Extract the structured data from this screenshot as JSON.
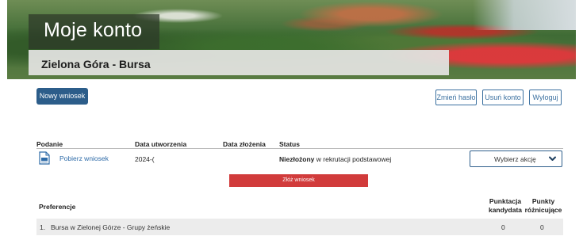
{
  "banner": {
    "title": "Moje konto",
    "subtitle": "Zielona Góra - Bursa"
  },
  "actions": {
    "new_application": "Nowy wniosek",
    "change_password": "Zmień hasło",
    "delete_account": "Usuń konto",
    "logout": "Wyloguj"
  },
  "applications": {
    "columns": {
      "application": "Podanie",
      "created": "Data utworzenia",
      "submitted": "Data złożenia",
      "status": "Status"
    },
    "rows": [
      {
        "download_label": "Pobierz wniosek",
        "created": "2024-(",
        "submitted": "",
        "status_bold": "Niezłożony",
        "status_rest": " w rekrutacji podstawowej",
        "action_select": "Wybierz akcję"
      }
    ],
    "submit_button": "Złóż wniosek"
  },
  "preferences": {
    "title": "Preferencje",
    "col_points_line1": "Punktacja",
    "col_points_line2": "kandydata",
    "col_tiebreak_line1": "Punkty",
    "col_tiebreak_line2": "różnicujące",
    "items": [
      {
        "num": "1.",
        "name": "Bursa w Zielonej Górze - Grupy żeńskie",
        "points": "0",
        "tiebreak": "0"
      }
    ]
  },
  "colors": {
    "primary": "#2c5d8a",
    "link": "#2e6ba8",
    "submit": "#d13b3b",
    "row_bg": "#ececec"
  },
  "icons": {
    "pdf": "pdf-file-icon",
    "chevron": "chevron-down-icon"
  }
}
